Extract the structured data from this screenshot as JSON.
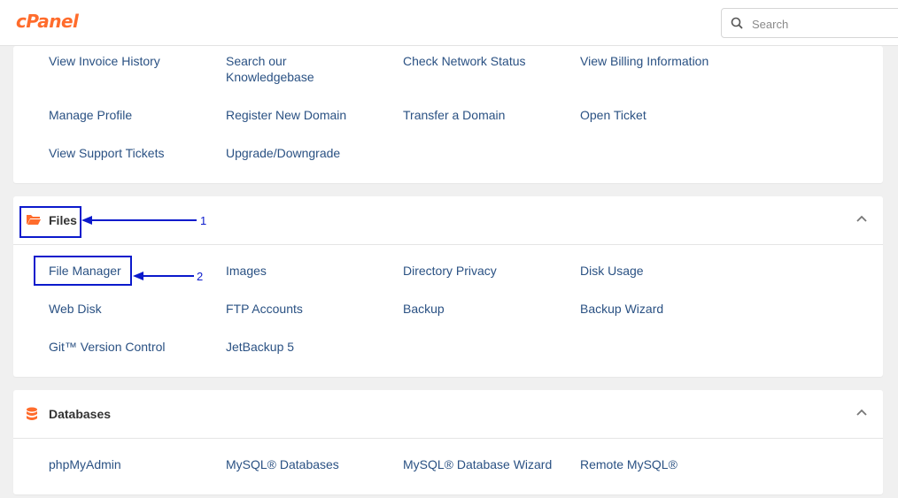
{
  "header": {
    "logo_text": "cPanel",
    "search_placeholder": "Search"
  },
  "sections": [
    {
      "title": "",
      "links": [
        [
          "View Invoice History",
          "Search our Knowledgebase",
          "Check Network Status",
          "View Billing Information"
        ],
        [
          "Manage Profile",
          "Register New Domain",
          "Transfer a Domain",
          "Open Ticket"
        ],
        [
          "View Support Tickets",
          "Upgrade/Downgrade"
        ]
      ]
    },
    {
      "title": "Files",
      "icon": "folder-icon",
      "links": [
        [
          "File Manager",
          "Images",
          "Directory Privacy",
          "Disk Usage"
        ],
        [
          "Web Disk",
          "FTP Accounts",
          "Backup",
          "Backup Wizard"
        ],
        [
          "Git™ Version Control",
          "JetBackup 5"
        ]
      ]
    },
    {
      "title": "Databases",
      "icon": "database-icon",
      "links": [
        [
          "phpMyAdmin",
          "MySQL® Databases",
          "MySQL® Database Wizard",
          "Remote MySQL®"
        ]
      ]
    }
  ],
  "annotations": [
    "1",
    "2"
  ],
  "colors": {
    "brand": "#ff6c2c",
    "link": "#2a5183",
    "annotation": "#0b1acc"
  }
}
